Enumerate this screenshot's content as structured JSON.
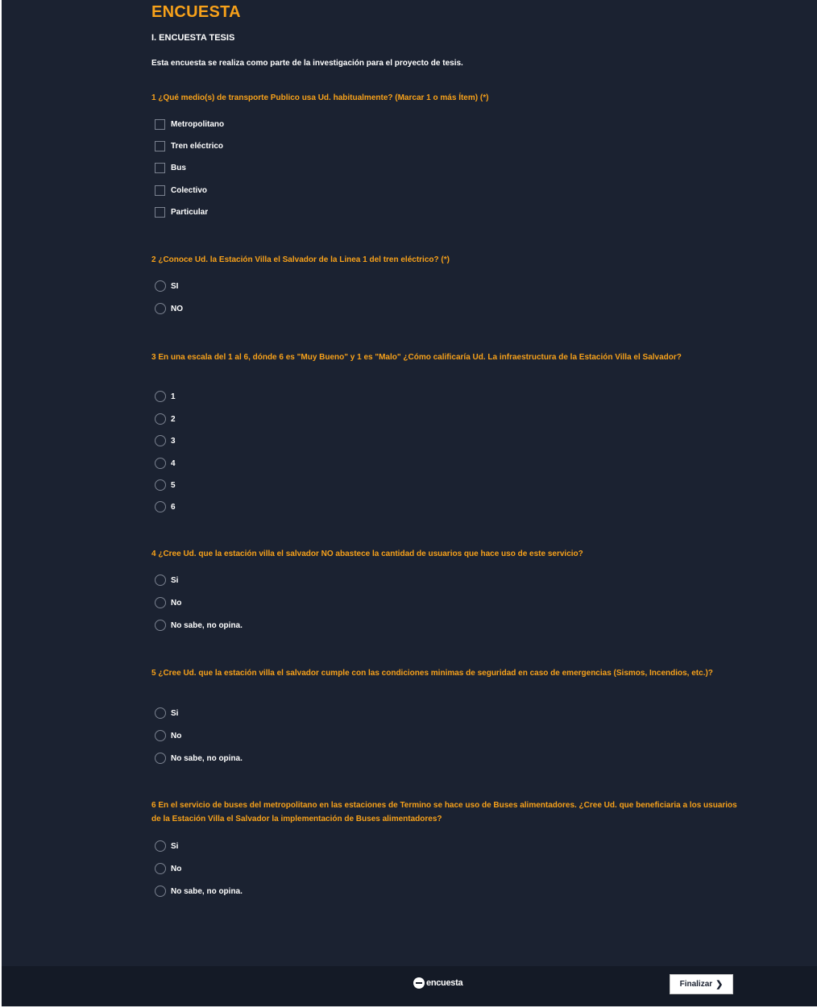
{
  "survey": {
    "title": "ENCUESTA",
    "section": "I. ENCUESTA TESIS",
    "intro": "Esta encuesta se realiza como parte de la investigación para el proyecto de tesis."
  },
  "questions": [
    {
      "text": "1 ¿Qué medio(s) de transporte Publico usa Ud. habitualmente? (Marcar 1 o más Ítem) (*)",
      "type": "checkbox",
      "options": [
        "Metropolitano",
        "Tren eléctrico",
        "Bus",
        "Colectivo",
        "Particular"
      ]
    },
    {
      "text": "2 ¿Conoce Ud. la Estación Villa el Salvador de la Linea 1 del tren eléctrico? (*)",
      "type": "radio",
      "options": [
        "SI",
        "NO"
      ]
    },
    {
      "text": "3 En una escala del 1 al 6, dónde 6 es \"Muy Bueno\" y 1 es \"Malo\" ¿Cómo calificaría Ud. La infraestructura de la Estación Villa el Salvador?",
      "type": "radio",
      "options": [
        "1",
        "2",
        "3",
        "4",
        "5",
        "6"
      ]
    },
    {
      "text": "4 ¿Cree Ud. que la estación villa el salvador NO abastece la cantidad de usuarios que hace uso de este servicio?",
      "type": "radio",
      "options": [
        "Si",
        "No",
        "No sabe, no opina."
      ]
    },
    {
      "text": "5 ¿Cree Ud. que la estación villa el salvador cumple con las condiciones minimas de seguridad en caso de emergencias (Sismos, Incendios, etc.)?",
      "type": "radio",
      "options": [
        "Si",
        "No",
        "No sabe, no opina."
      ]
    },
    {
      "text": "6 En el servicio de buses del metropolitano en las estaciones de Termino se hace uso de Buses alimentadores. ¿Cree Ud. que beneficiaria a los usuarios de la Estación Villa el Salvador la implementación de Buses alimentadores?",
      "type": "radio",
      "options": [
        "Si",
        "No",
        "No sabe, no opina."
      ]
    }
  ],
  "footer": {
    "logo_text": "encuesta",
    "finish_label": "Finalizar",
    "finish_icon": "chevron-right-icon"
  },
  "colors": {
    "background": "#1b2231",
    "accent": "#f7a11a",
    "footer": "#141a26"
  }
}
